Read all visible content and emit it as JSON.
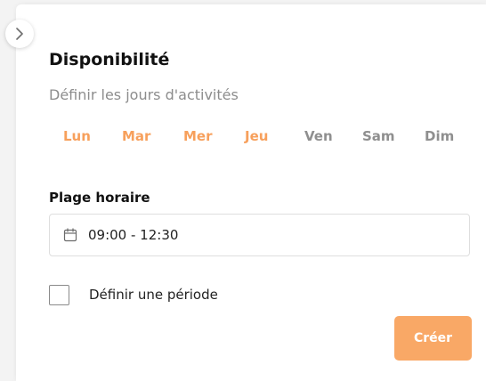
{
  "panel": {
    "title": "Disponibilité",
    "subtitle": "Définir les jours d'activités"
  },
  "days": [
    {
      "label": "Lun",
      "active": true
    },
    {
      "label": "Mar",
      "active": true
    },
    {
      "label": "Mer",
      "active": true
    },
    {
      "label": "Jeu",
      "active": true
    },
    {
      "label": "Ven",
      "active": false
    },
    {
      "label": "Sam",
      "active": false
    },
    {
      "label": "Dim",
      "active": false
    }
  ],
  "time_range": {
    "label": "Plage horaire",
    "value": "09:00 - 12:30",
    "icon": "calendar-icon"
  },
  "period": {
    "label": "Définir une période",
    "checked": false
  },
  "actions": {
    "create_label": "Créer"
  },
  "colors": {
    "accent": "#f7a05c",
    "button": "#f9a866",
    "inactive_day": "#8f8f8f"
  }
}
